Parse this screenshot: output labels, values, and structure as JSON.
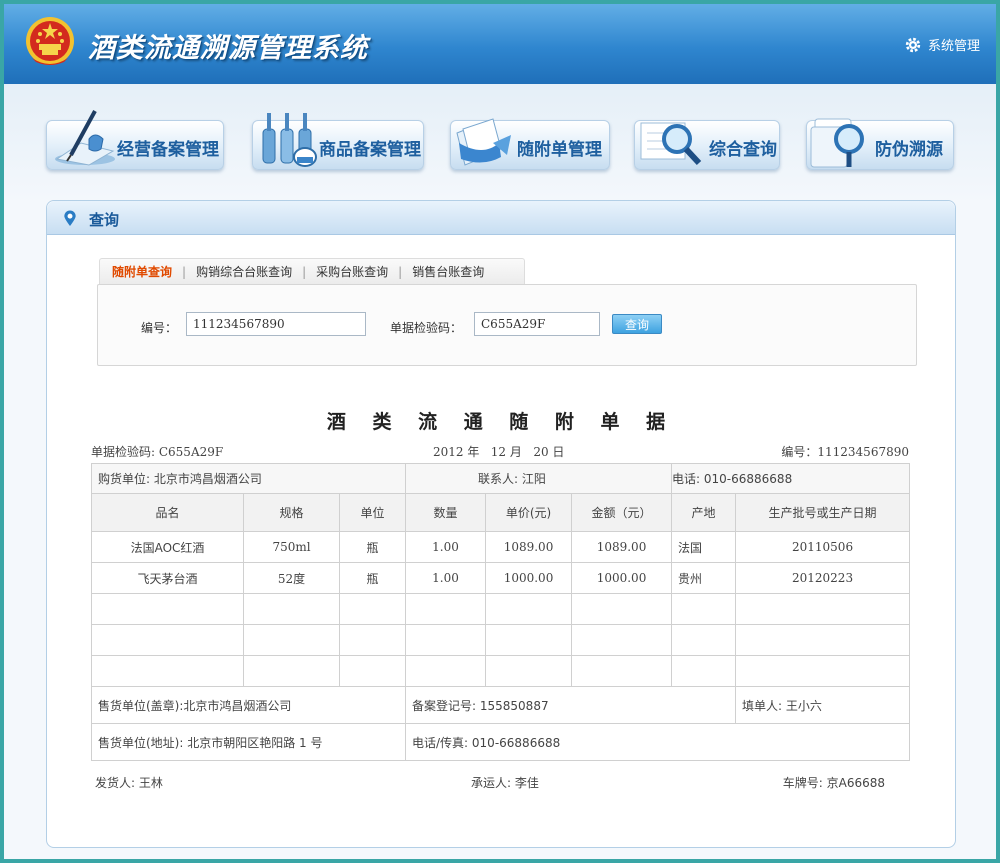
{
  "header": {
    "app_title": "酒类流通溯源管理系统",
    "system_management": "系统管理"
  },
  "nav": [
    {
      "label": "经营备案管理",
      "icon": "pen-inkpot-icon"
    },
    {
      "label": "商品备案管理",
      "icon": "bottles-icon"
    },
    {
      "label": "随附单管理",
      "icon": "documents-icon"
    },
    {
      "label": "综合查询",
      "icon": "magnifier-icon"
    },
    {
      "label": "防伪溯源",
      "icon": "trace-magnifier-icon"
    }
  ],
  "panel": {
    "title": "查询",
    "tabs": [
      "随附单查询",
      "购销综合台账查询",
      "采购台账查询",
      "销售台账查询"
    ],
    "active_tab": 0
  },
  "search": {
    "number_label": "编号：",
    "number_value": "111234567890",
    "code_label": "单据检验码：",
    "code_value": "C655A29F",
    "button": "查询"
  },
  "doc": {
    "title": "酒 类 流 通 随 附 单 据",
    "check_code": "单据检验码: C655A29F",
    "date": "2012 年   12 月   20 日",
    "number": "编号：111234567890",
    "buyer": "购货单位: 北京市鸿昌烟酒公司",
    "contact": "联系人: 江阳",
    "phone": "电话: 010-66886688",
    "columns": [
      "品名",
      "规格",
      "单位",
      "数量",
      "单价(元)",
      "金额（元）",
      "产地",
      "生产批号或生产日期"
    ],
    "rows": [
      [
        "法国AOC红酒",
        "750ml",
        "瓶",
        "1.00",
        "1089.00",
        "1089.00",
        "法国",
        "20110506"
      ],
      [
        "飞天茅台酒",
        "52度",
        "瓶",
        "1.00",
        "1000.00",
        "1000.00",
        "贵州",
        "20120223"
      ]
    ],
    "seller_seal": "售货单位(盖章):北京市鸿昌烟酒公司",
    "record_no": "备案登记号: 155850887",
    "filler": "填单人: 王小六",
    "seller_address": "售货单位(地址): 北京市朝阳区艳阳路 1 号",
    "fax": "电话/传真: 010-66886688",
    "shipper": "发货人: 王林",
    "carrier": "承运人: 李佳",
    "plate": "车牌号: 京A66688"
  }
}
